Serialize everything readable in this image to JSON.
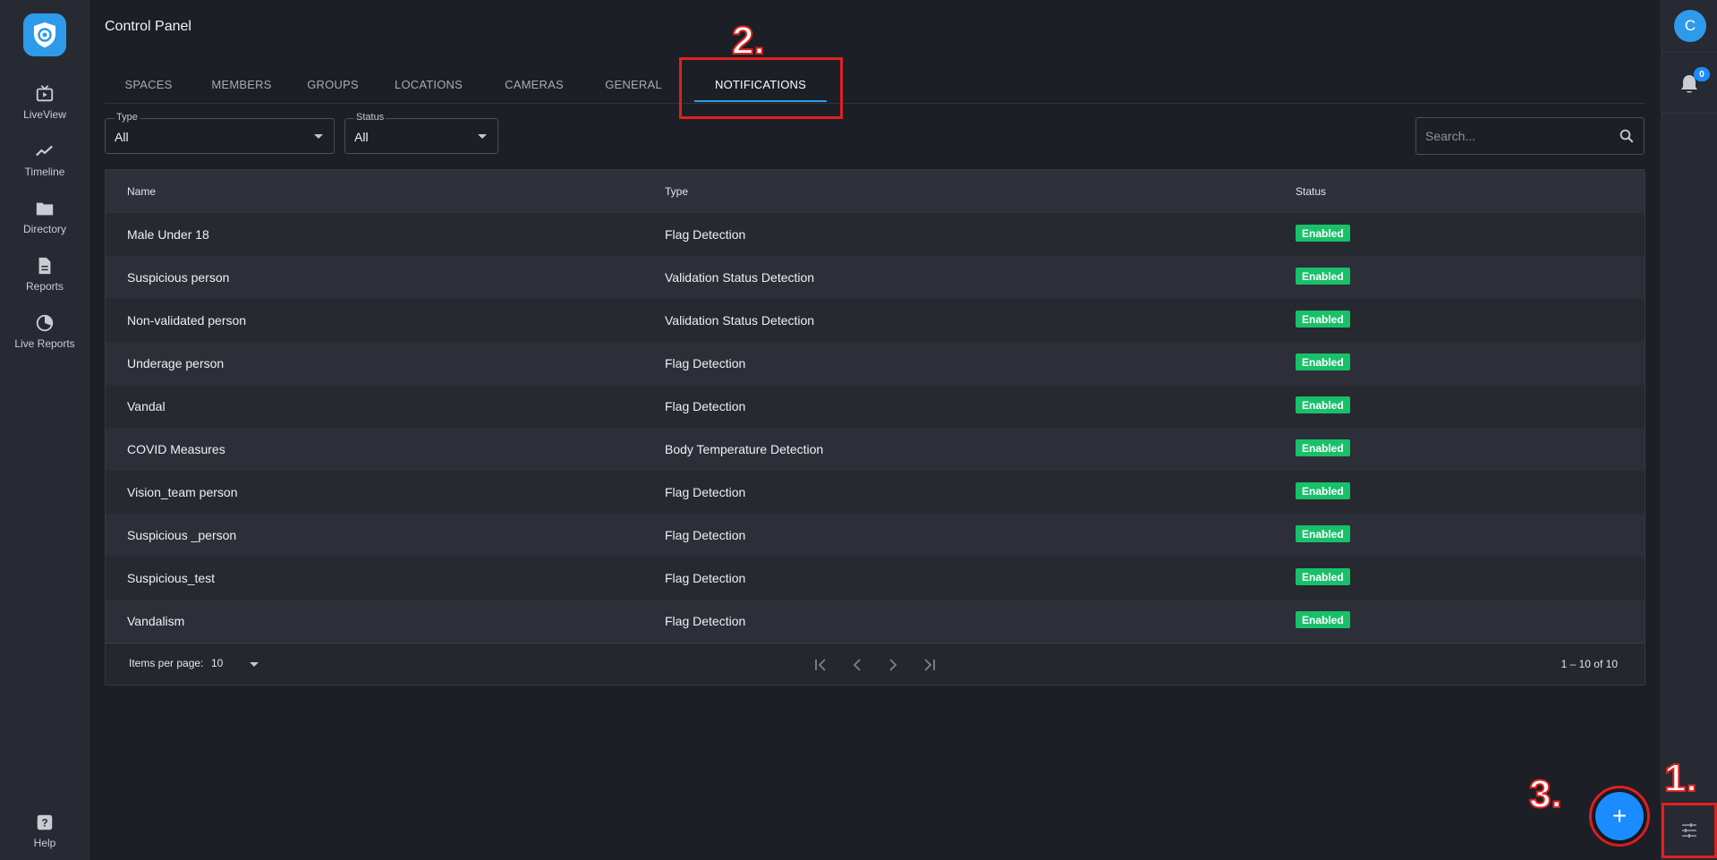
{
  "nav": {
    "items": [
      {
        "label": "LiveView",
        "icon": "liveview-icon"
      },
      {
        "label": "Timeline",
        "icon": "timeline-icon"
      },
      {
        "label": "Directory",
        "icon": "folder-icon"
      },
      {
        "label": "Reports",
        "icon": "report-icon"
      },
      {
        "label": "Live Reports",
        "icon": "live-reports-icon"
      }
    ],
    "help_label": "Help"
  },
  "header": {
    "title": "Control Panel"
  },
  "tabs": [
    "SPACES",
    "MEMBERS",
    "GROUPS",
    "LOCATIONS",
    "CAMERAS",
    "GENERAL",
    "NOTIFICATIONS"
  ],
  "active_tab": "NOTIFICATIONS",
  "filters": {
    "type": {
      "label": "Type",
      "value": "All"
    },
    "status": {
      "label": "Status",
      "value": "All"
    }
  },
  "search": {
    "placeholder": "Search..."
  },
  "table": {
    "columns": [
      "Name",
      "Type",
      "Status"
    ],
    "rows": [
      {
        "name": "Male Under 18",
        "type": "Flag Detection",
        "status": "Enabled"
      },
      {
        "name": "Suspicious person",
        "type": "Validation Status Detection",
        "status": "Enabled"
      },
      {
        "name": "Non-validated person",
        "type": "Validation Status Detection",
        "status": "Enabled"
      },
      {
        "name": "Underage person",
        "type": "Flag Detection",
        "status": "Enabled"
      },
      {
        "name": "Vandal",
        "type": "Flag Detection",
        "status": "Enabled"
      },
      {
        "name": "COVID Measures",
        "type": "Body Temperature Detection",
        "status": "Enabled"
      },
      {
        "name": "Vision_team person",
        "type": "Flag Detection",
        "status": "Enabled"
      },
      {
        "name": "Suspicious _person",
        "type": "Flag Detection",
        "status": "Enabled"
      },
      {
        "name": "Suspicious_test",
        "type": "Flag Detection",
        "status": "Enabled"
      },
      {
        "name": "Vandalism",
        "type": "Flag Detection",
        "status": "Enabled"
      }
    ]
  },
  "paginator": {
    "items_per_page_label": "Items per page:",
    "items_per_page": "10",
    "range": "1 – 10 of 10"
  },
  "user": {
    "initial": "C"
  },
  "notifications": {
    "count": "0"
  },
  "fab": {
    "label": "+"
  },
  "annotations": [
    "1.",
    "2.",
    "3."
  ],
  "colors": {
    "accent": "#2e9bea",
    "status_enabled": "#19c06a",
    "annotation": "#e02020",
    "background": "#1d1f26"
  }
}
